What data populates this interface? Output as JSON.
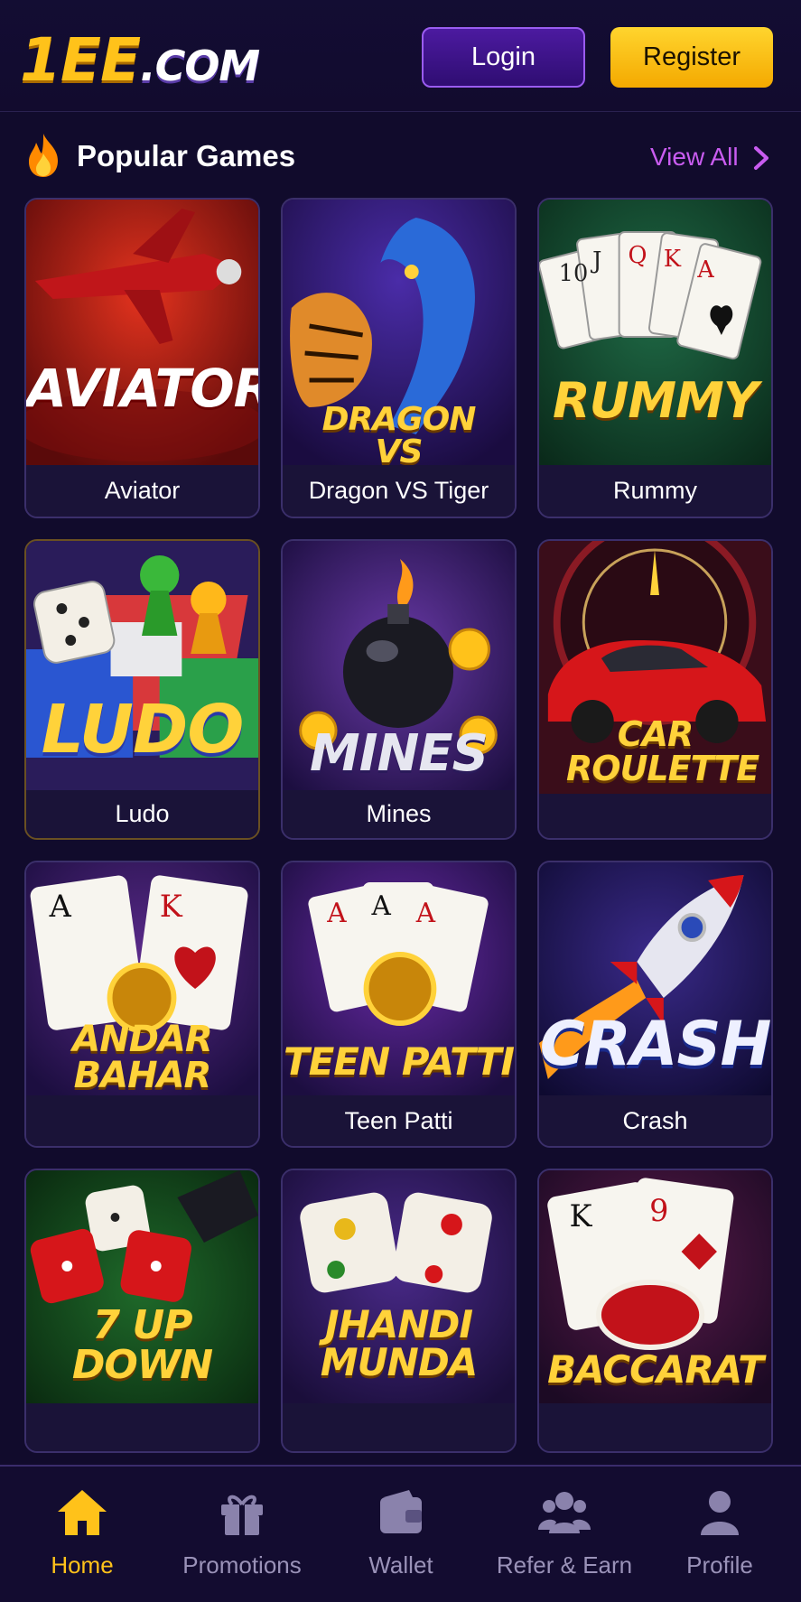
{
  "header": {
    "logo_main": "1EE",
    "logo_suffix": ".COM",
    "login_label": "Login",
    "register_label": "Register"
  },
  "section": {
    "title": "Popular Games",
    "view_all_label": "View All"
  },
  "games": [
    {
      "art_title": "AVIATOR",
      "label": "Aviator"
    },
    {
      "art_title": "DRAGON VS TIGER",
      "label": "Dragon VS Tiger"
    },
    {
      "art_title": "RUMMY",
      "label": "Rummy"
    },
    {
      "art_title": "LUDO",
      "label": "Ludo"
    },
    {
      "art_title": "MINES",
      "label": "Mines"
    },
    {
      "art_title": "CAR ROULETTE",
      "label": ""
    },
    {
      "art_title": "ANDAR BAHAR",
      "label": ""
    },
    {
      "art_title": "TEEN PATTI",
      "label": "Teen Patti"
    },
    {
      "art_title": "CRASH",
      "label": "Crash"
    },
    {
      "art_title": "7 UP DOWN",
      "label": ""
    },
    {
      "art_title": "JHANDI MUNDA",
      "label": ""
    },
    {
      "art_title": "BACCARAT",
      "label": ""
    }
  ],
  "nav": [
    {
      "label": "Home",
      "icon": "home-icon",
      "active": true
    },
    {
      "label": "Promotions",
      "icon": "gift-icon",
      "active": false
    },
    {
      "label": "Wallet",
      "icon": "wallet-icon",
      "active": false
    },
    {
      "label": "Refer & Earn",
      "icon": "users-icon",
      "active": false
    },
    {
      "label": "Profile",
      "icon": "profile-icon",
      "active": false
    }
  ],
  "colors": {
    "background": "#110b2c",
    "accent_gold": "#ffc21a",
    "accent_purple": "#c95cf0",
    "nav_inactive": "#9a92b8"
  }
}
